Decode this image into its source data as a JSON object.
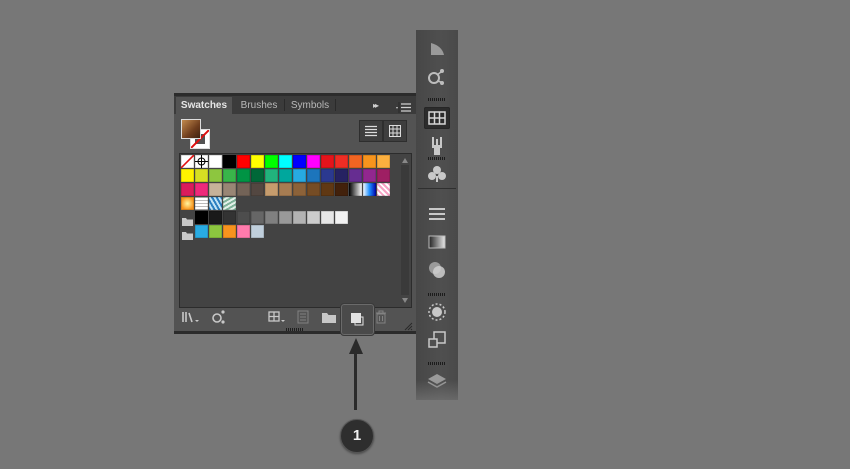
{
  "panel": {
    "tabs": [
      {
        "label": "Swatches",
        "active": true
      },
      {
        "label": "Brushes",
        "active": false
      },
      {
        "label": "Symbols",
        "active": false
      }
    ],
    "collapse_glyph": "▸▸",
    "menu_icon": "panel-menu-icon",
    "fill_color": "#8a5a2e",
    "view_modes": [
      "list-view",
      "thumbnail-view"
    ],
    "active_view": "thumbnail-view",
    "swatch_rows": [
      {
        "group": false,
        "colors": [
          "none",
          "registration",
          "#ffffff",
          "#000000",
          "#ff0000",
          "#ffff00",
          "#00ff00",
          "#00ffff",
          "#0000ff",
          "#ff00ff",
          "#e4141b",
          "#ee2d24",
          "#f26522",
          "#f7941d",
          "#fbaf3f"
        ]
      },
      {
        "group": false,
        "colors": [
          "#fff200",
          "#d7df23",
          "#8dc63f",
          "#39b54a",
          "#009444",
          "#006838",
          "#21b37d",
          "#00a79d",
          "#27aae1",
          "#1c75bc",
          "#2b3990",
          "#262262",
          "#662d91",
          "#92278f",
          "#9e1f63"
        ]
      },
      {
        "group": false,
        "colors": [
          "#da1c5c",
          "#ee2a7b",
          "#c7b299",
          "#998675",
          "#736357",
          "#534741",
          "#c69c6d",
          "#a67c52",
          "#8c6239",
          "#754c24",
          "#603813",
          "#42210b",
          "gradient-bw",
          "gradient-blue",
          "pattern-pink"
        ]
      },
      {
        "group": false,
        "colors": [
          "gradient-orange",
          "pattern-grid",
          "pattern-blue",
          "pattern-green"
        ]
      },
      {
        "group": true,
        "colors": [
          "#000000",
          "#1a1a1a",
          "#333333",
          "#4d4d4d",
          "#666666",
          "#808080",
          "#999999",
          "#b3b3b3",
          "#cccccc",
          "#e6e6e6",
          "#f2f2f2"
        ]
      },
      {
        "group": true,
        "colors": [
          "#29abe2",
          "#8cc63f",
          "#f7931e",
          "#ff7bac",
          "#c0cfdc"
        ]
      }
    ],
    "bottom_buttons": [
      {
        "icon": "swatch-libraries-menu-icon",
        "enabled": true
      },
      {
        "icon": "add-to-library-icon",
        "enabled": true
      },
      {
        "icon": "show-swatch-kinds-menu-icon",
        "enabled": true
      },
      {
        "icon": "swatch-options-icon",
        "enabled": false
      },
      {
        "icon": "new-color-group-icon",
        "enabled": true
      },
      {
        "icon": "new-swatch-icon",
        "enabled": true
      },
      {
        "icon": "delete-swatch-icon",
        "enabled": false
      }
    ]
  },
  "dock": {
    "items": [
      "transparency-icon",
      "libraries-icon",
      "swatches-icon",
      "brushes-icon",
      "symbols-icon",
      "stroke-icon",
      "gradient-icon",
      "transparency-circles-icon",
      "appearance-icon",
      "artboards-icon",
      "layers-icon"
    ],
    "active_item": "swatches-icon"
  },
  "callout": {
    "number": "1"
  }
}
